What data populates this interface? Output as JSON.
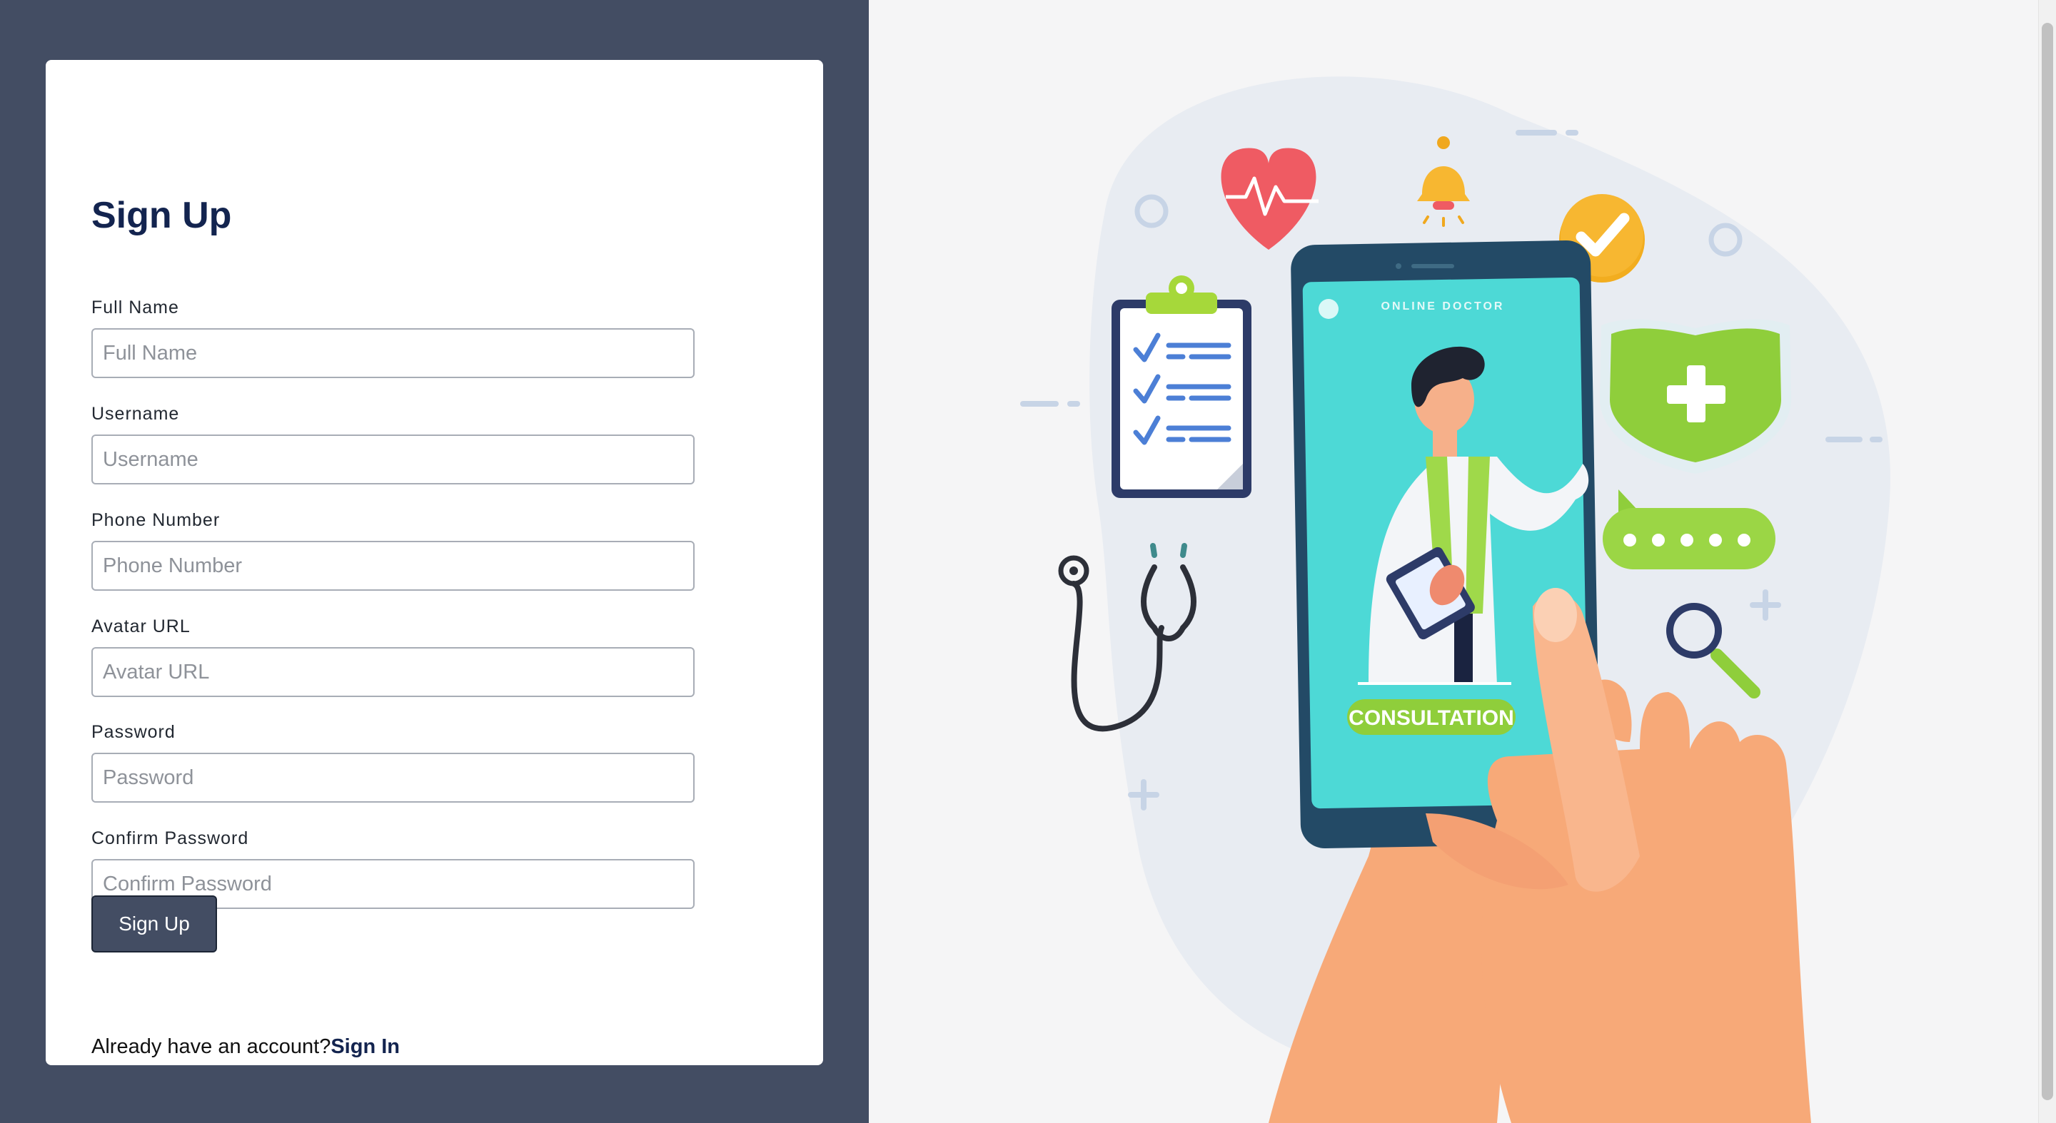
{
  "form": {
    "title": "Sign Up",
    "fields": [
      {
        "label": "Full Name",
        "placeholder": "Full Name",
        "value": ""
      },
      {
        "label": "Username",
        "placeholder": "Username",
        "value": ""
      },
      {
        "label": "Phone Number",
        "placeholder": "Phone Number",
        "value": ""
      },
      {
        "label": "Avatar URL",
        "placeholder": "Avatar URL",
        "value": ""
      },
      {
        "label": "Password",
        "placeholder": "Password",
        "value": ""
      },
      {
        "label": "Confirm Password",
        "placeholder": "Confirm Password",
        "value": ""
      }
    ],
    "submit_label": "Sign Up",
    "signin_prompt": "Already have an account?",
    "signin_link": "Sign In"
  },
  "illustration": {
    "screen_title": "ONLINE DOCTOR",
    "badge": "CONSULTATION"
  },
  "colors": {
    "left_panel": "#434d63",
    "heading": "#13244f",
    "phone_screen": "#4dd9d6",
    "accent_green": "#8fce3b",
    "heart": "#ef5b63",
    "skin": "#f7a978"
  }
}
